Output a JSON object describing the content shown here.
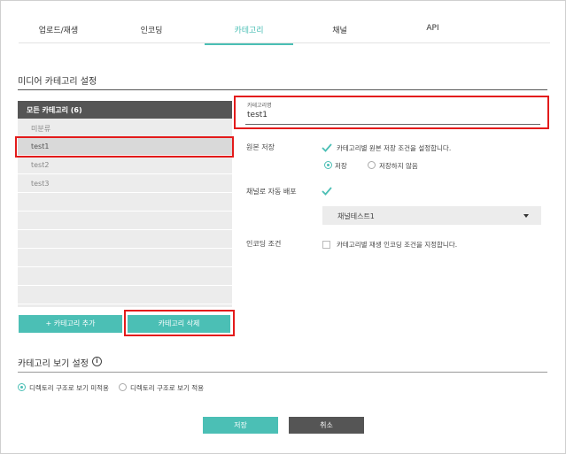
{
  "tabs": [
    {
      "label": "업로드/재생",
      "active": false
    },
    {
      "label": "인코딩",
      "active": false
    },
    {
      "label": "카테고리",
      "active": true
    },
    {
      "label": "채널",
      "active": false
    },
    {
      "label": "API",
      "active": false
    }
  ],
  "media_section": {
    "title": "미디어 카테고리 설정"
  },
  "category_list": {
    "header": "모든 카테고리 (6)",
    "items": [
      {
        "label": "미분류",
        "selected": false
      },
      {
        "label": "test1",
        "selected": true
      },
      {
        "label": "test2",
        "selected": false
      },
      {
        "label": "test3",
        "selected": false
      }
    ],
    "add_button": "+ 카테고리 추가",
    "delete_button": "카테고리 삭제"
  },
  "form": {
    "name_label": "카테고리명",
    "name_value": "test1",
    "original_save": {
      "label": "원본 저장",
      "checked": true,
      "description": "카테고리별 원본 저장 조건을 설정합니다.",
      "options": [
        {
          "label": "저장",
          "selected": true
        },
        {
          "label": "저장하지 않음",
          "selected": false
        }
      ]
    },
    "auto_distribute": {
      "label": "채널로 자동 배포",
      "checked": true,
      "selected_channel": "채널테스트1"
    },
    "encoding": {
      "label": "인코딩 조건",
      "checked": false,
      "description": "카테고리별 재생 인코딩 조건을 지정합니다."
    }
  },
  "view_section": {
    "title": "카테고리 보기 설정",
    "info_icon": "i",
    "options": [
      {
        "label": "디렉토리 구조로 보기 미적용",
        "selected": true
      },
      {
        "label": "디렉토리 구조로 보기 적용",
        "selected": false
      }
    ]
  },
  "footer": {
    "save": "저장",
    "cancel": "취소"
  },
  "colors": {
    "accent": "#4bbfb5",
    "dark": "#555555",
    "highlight": "#e31b1b"
  }
}
